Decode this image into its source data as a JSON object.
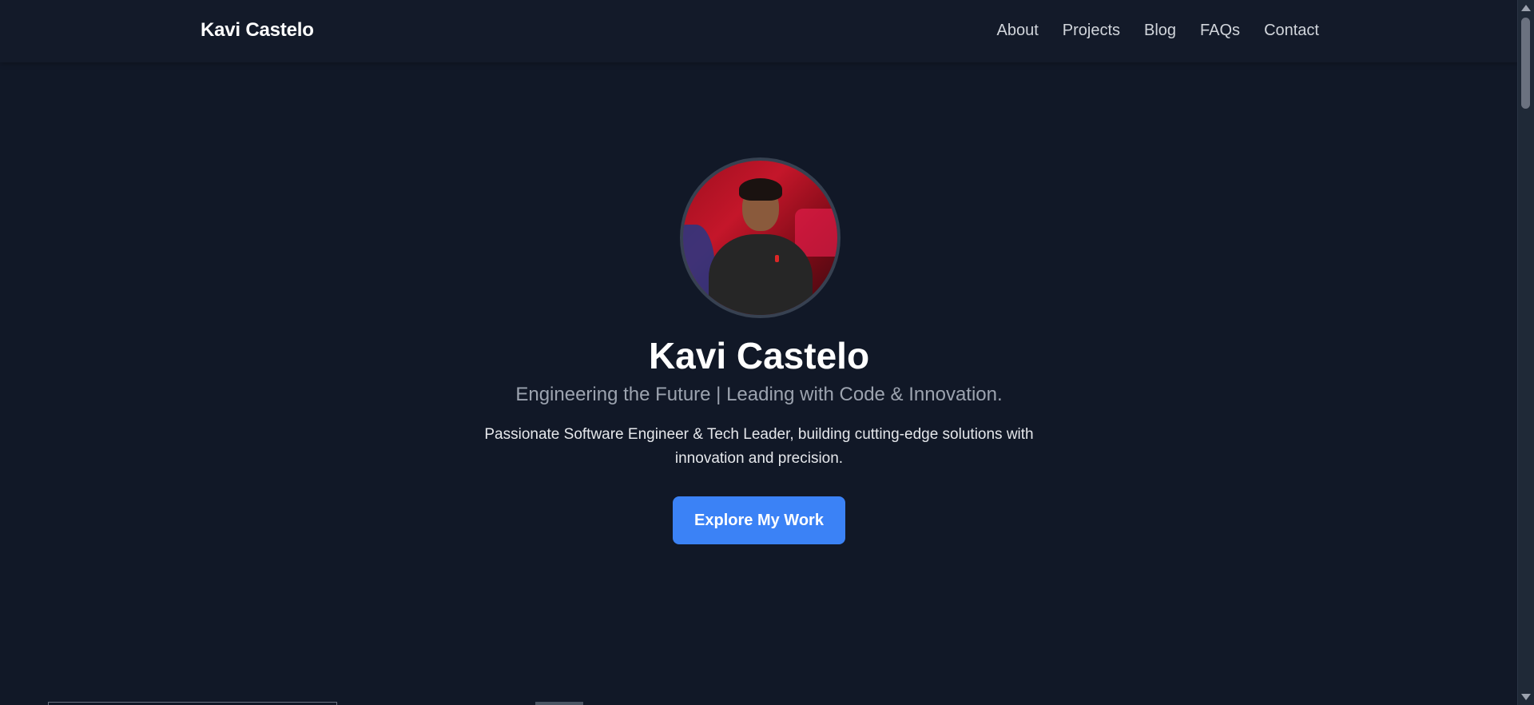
{
  "navbar": {
    "brand": "Kavi Castelo",
    "links": [
      {
        "label": "About"
      },
      {
        "label": "Projects"
      },
      {
        "label": "Blog"
      },
      {
        "label": "FAQs"
      },
      {
        "label": "Contact"
      }
    ]
  },
  "hero": {
    "avatar_icon": "profile-photo",
    "name": "Kavi Castelo",
    "tagline": "Engineering the Future | Leading with Code & Innovation.",
    "description": "Passionate Software Engineer & Tech Leader, building cutting-edge solutions with innovation and precision.",
    "cta_label": "Explore My Work"
  },
  "colors": {
    "background": "#111827",
    "accent": "#3b82f6",
    "muted_text": "#9ca3af"
  }
}
